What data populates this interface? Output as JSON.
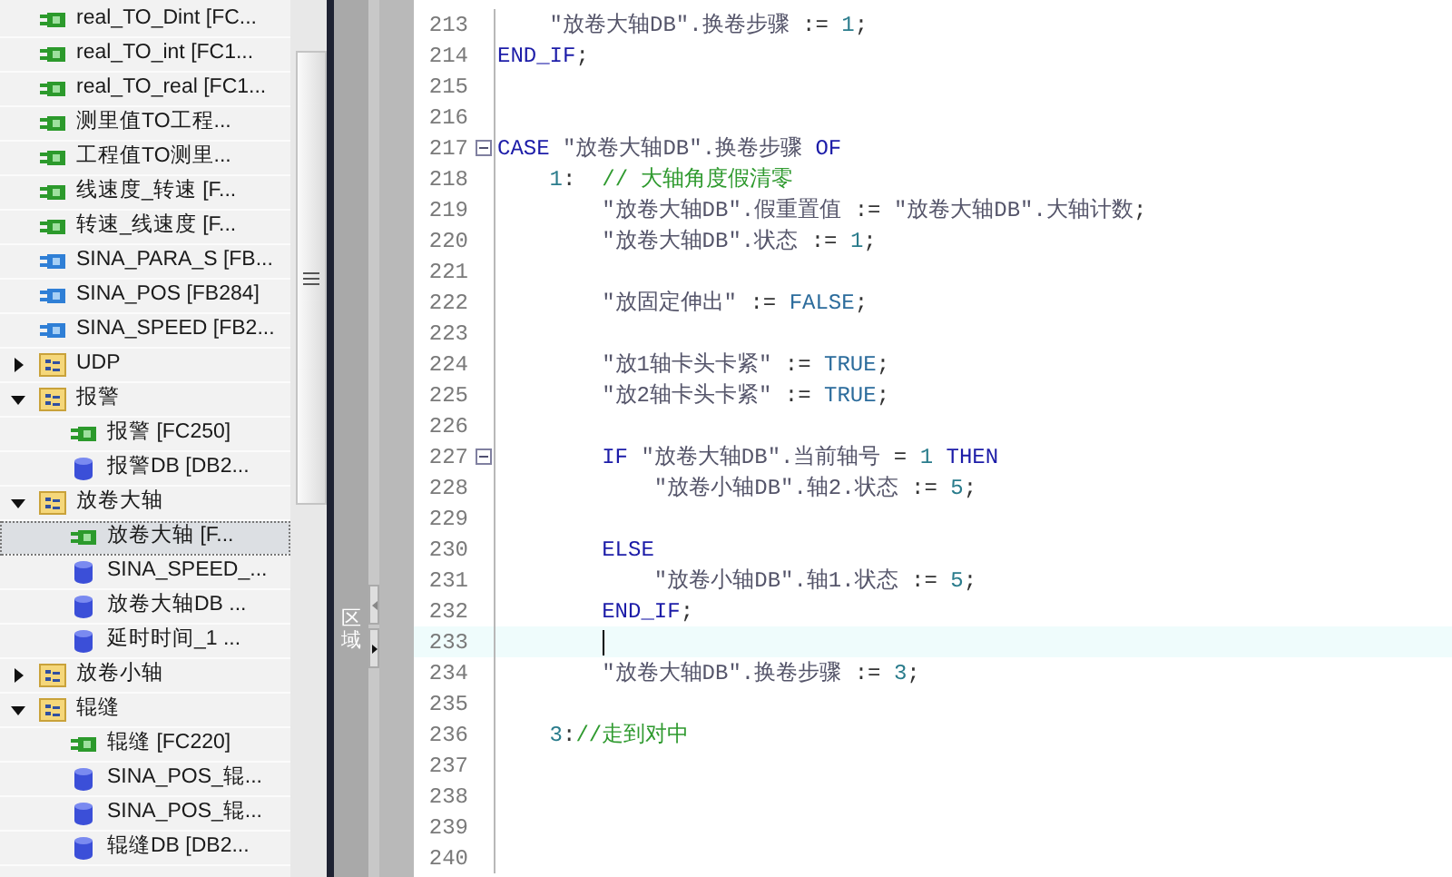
{
  "project_tree": {
    "items": [
      {
        "kind": "fc",
        "label": "real_TO_Dint [FC...",
        "selected": false
      },
      {
        "kind": "fc",
        "label": "real_TO_int [FC1...",
        "selected": false
      },
      {
        "kind": "fc",
        "label": "real_TO_real [FC1...",
        "selected": false
      },
      {
        "kind": "fc",
        "label": "测里值TO工程...",
        "selected": false
      },
      {
        "kind": "fc",
        "label": "工程值TO测里...",
        "selected": false
      },
      {
        "kind": "fc",
        "label": "线速度_转速 [F...",
        "selected": false
      },
      {
        "kind": "fc",
        "label": "转速_线速度 [F...",
        "selected": false
      },
      {
        "kind": "fb",
        "label": "SINA_PARA_S [FB...",
        "selected": false
      },
      {
        "kind": "fb",
        "label": "SINA_POS [FB284]",
        "selected": false
      },
      {
        "kind": "fb",
        "label": "SINA_SPEED [FB2...",
        "selected": false
      },
      {
        "kind": "folder",
        "label": "UDP",
        "expanded": false,
        "selected": false
      },
      {
        "kind": "folder",
        "label": "报警",
        "expanded": true,
        "selected": false,
        "children": [
          {
            "kind": "fc",
            "label": "报警 [FC250]",
            "selected": false
          },
          {
            "kind": "db",
            "label": "报警DB [DB2...",
            "selected": false
          }
        ]
      },
      {
        "kind": "folder",
        "label": "放卷大轴",
        "expanded": true,
        "selected": false,
        "children": [
          {
            "kind": "fc",
            "label": "放卷大轴 [F...",
            "selected": true
          },
          {
            "kind": "db",
            "label": "SINA_SPEED_...",
            "selected": false
          },
          {
            "kind": "db",
            "label": "放卷大轴DB ...",
            "selected": false
          },
          {
            "kind": "db",
            "label": "延时时间_1 ...",
            "selected": false
          }
        ]
      },
      {
        "kind": "folder",
        "label": "放卷小轴",
        "expanded": false,
        "selected": false
      },
      {
        "kind": "folder",
        "label": "辊缝",
        "expanded": true,
        "selected": false,
        "children": [
          {
            "kind": "fc",
            "label": "辊缝 [FC220]",
            "selected": false
          },
          {
            "kind": "db",
            "label": "SINA_POS_辊...",
            "selected": false
          },
          {
            "kind": "db",
            "label": "SINA_POS_辊...",
            "selected": false
          },
          {
            "kind": "db",
            "label": "辊缝DB [DB2...",
            "selected": false
          }
        ]
      }
    ]
  },
  "side_panel": {
    "label": "区域"
  },
  "editor": {
    "lines": [
      {
        "number": "213",
        "segments": [
          {
            "kind": "tag",
            "text": "    \"放卷大轴DB\".换卷步骤"
          },
          {
            "kind": "plain",
            "text": " := "
          },
          {
            "kind": "number",
            "text": "1"
          },
          {
            "kind": "plain",
            "text": ";"
          }
        ]
      },
      {
        "number": "214",
        "segments": [
          {
            "kind": "keyword",
            "text": "END_IF"
          },
          {
            "kind": "plain",
            "text": ";"
          }
        ]
      },
      {
        "number": "215"
      },
      {
        "number": "216"
      },
      {
        "number": "217",
        "folded": false,
        "segments": [
          {
            "kind": "keyword",
            "text": "CASE "
          },
          {
            "kind": "tag",
            "text": "\"放卷大轴DB\".换卷步骤 "
          },
          {
            "kind": "keyword",
            "text": "OF"
          }
        ]
      },
      {
        "number": "218",
        "segments": [
          {
            "kind": "number",
            "text": "    1"
          },
          {
            "kind": "plain",
            "text": ":  "
          },
          {
            "kind": "comment",
            "text": "// 大轴角度假清零"
          }
        ]
      },
      {
        "number": "219",
        "segments": [
          {
            "kind": "tag",
            "text": "        \"放卷大轴DB\".假重置值"
          },
          {
            "kind": "plain",
            "text": " := "
          },
          {
            "kind": "tag",
            "text": "\"放卷大轴DB\".大轴计数"
          },
          {
            "kind": "plain",
            "text": ";"
          }
        ]
      },
      {
        "number": "220",
        "segments": [
          {
            "kind": "tag",
            "text": "        \"放卷大轴DB\".状态"
          },
          {
            "kind": "plain",
            "text": " := "
          },
          {
            "kind": "number",
            "text": "1"
          },
          {
            "kind": "plain",
            "text": ";"
          }
        ]
      },
      {
        "number": "221"
      },
      {
        "number": "222",
        "segments": [
          {
            "kind": "tag",
            "text": "        \"放固定伸出\""
          },
          {
            "kind": "plain",
            "text": " := "
          },
          {
            "kind": "constant",
            "text": "FALSE"
          },
          {
            "kind": "plain",
            "text": ";"
          }
        ]
      },
      {
        "number": "223"
      },
      {
        "number": "224",
        "segments": [
          {
            "kind": "tag",
            "text": "        \"放1轴卡头卡紧\""
          },
          {
            "kind": "plain",
            "text": " := "
          },
          {
            "kind": "constant",
            "text": "TRUE"
          },
          {
            "kind": "plain",
            "text": ";"
          }
        ]
      },
      {
        "number": "225",
        "segments": [
          {
            "kind": "tag",
            "text": "        \"放2轴卡头卡紧\""
          },
          {
            "kind": "plain",
            "text": " := "
          },
          {
            "kind": "constant",
            "text": "TRUE"
          },
          {
            "kind": "plain",
            "text": ";"
          }
        ]
      },
      {
        "number": "226"
      },
      {
        "number": "227",
        "folded": false,
        "segments": [
          {
            "kind": "keyword",
            "text": "        IF "
          },
          {
            "kind": "tag",
            "text": "\"放卷大轴DB\".当前轴号"
          },
          {
            "kind": "plain",
            "text": " = "
          },
          {
            "kind": "number",
            "text": "1 "
          },
          {
            "kind": "keyword",
            "text": "THEN"
          }
        ]
      },
      {
        "number": "228",
        "segments": [
          {
            "kind": "tag",
            "text": "            \"放卷小轴DB\".轴2.状态"
          },
          {
            "kind": "plain",
            "text": " := "
          },
          {
            "kind": "number",
            "text": "5"
          },
          {
            "kind": "plain",
            "text": ";"
          }
        ]
      },
      {
        "number": "229"
      },
      {
        "number": "230",
        "segments": [
          {
            "kind": "keyword",
            "text": "        ELSE"
          }
        ]
      },
      {
        "number": "231",
        "segments": [
          {
            "kind": "tag",
            "text": "            \"放卷小轴DB\".轴1.状态"
          },
          {
            "kind": "plain",
            "text": " := "
          },
          {
            "kind": "number",
            "text": "5"
          },
          {
            "kind": "plain",
            "text": ";"
          }
        ]
      },
      {
        "number": "232",
        "segments": [
          {
            "kind": "keyword",
            "text": "        END_IF"
          },
          {
            "kind": "plain",
            "text": ";"
          }
        ]
      },
      {
        "number": "233",
        "current": true
      },
      {
        "number": "234",
        "segments": [
          {
            "kind": "tag",
            "text": "        \"放卷大轴DB\".换卷步骤"
          },
          {
            "kind": "plain",
            "text": " := "
          },
          {
            "kind": "number",
            "text": "3"
          },
          {
            "kind": "plain",
            "text": ";"
          }
        ]
      },
      {
        "number": "235"
      },
      {
        "number": "236",
        "segments": [
          {
            "kind": "number",
            "text": "    3"
          },
          {
            "kind": "plain",
            "text": ":"
          },
          {
            "kind": "comment",
            "text": "//走到对中"
          }
        ]
      },
      {
        "number": "237"
      },
      {
        "number": "238"
      },
      {
        "number": "239"
      },
      {
        "number": "240"
      }
    ]
  }
}
